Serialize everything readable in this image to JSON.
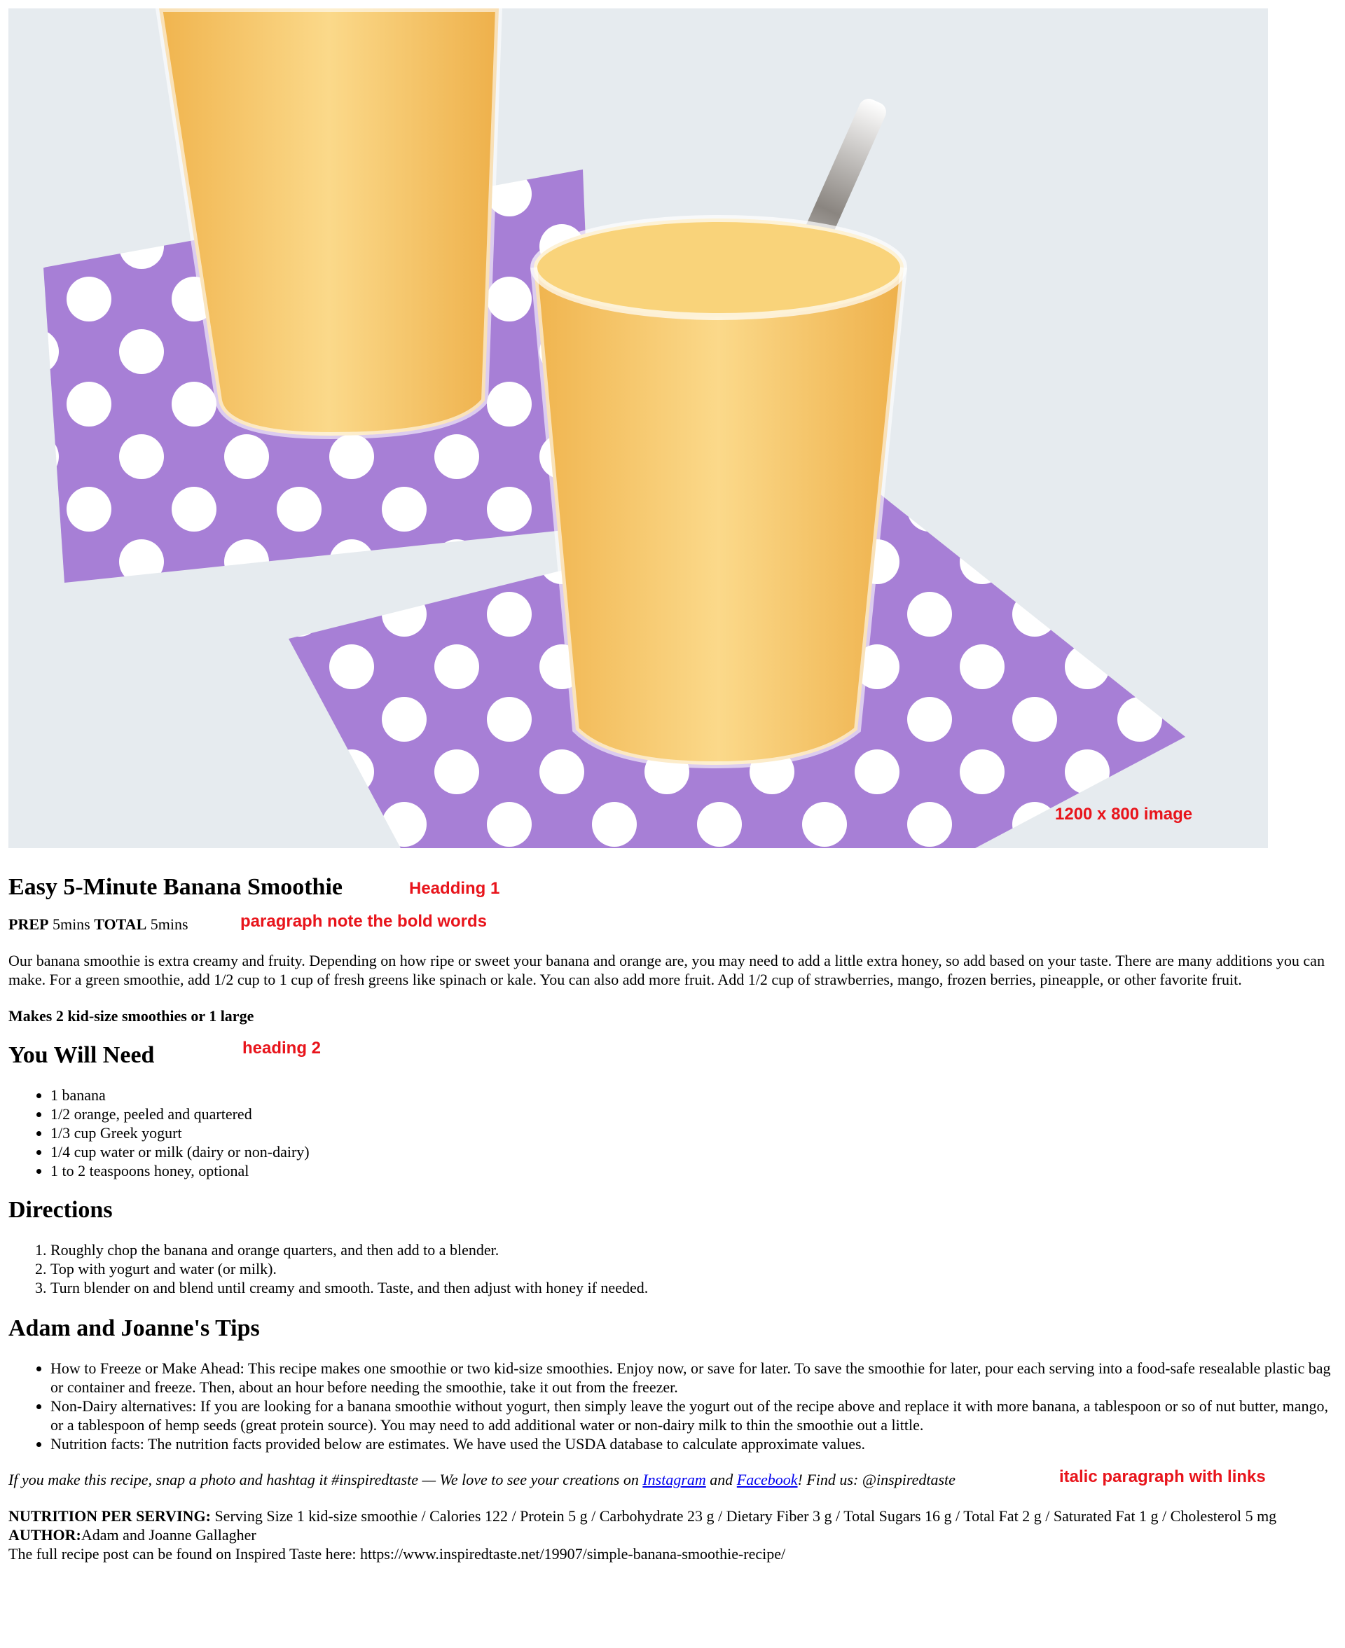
{
  "hero": {
    "note": "1200 x 800 image"
  },
  "title": {
    "text": "Easy 5-Minute Banana Smoothie",
    "note": "Headding 1"
  },
  "times": {
    "prep_label": "PREP",
    "prep_value": "5mins",
    "total_label": "TOTAL",
    "total_value": "5mins",
    "note": "paragraph note the bold words"
  },
  "intro": "Our banana smoothie is extra creamy and fruity. Depending on how ripe or sweet your banana and orange are, you may need to add a little extra honey, so add based on your taste. There are many additions you can make. For a green smoothie, add 1/2 cup to 1 cup of fresh greens like spinach or kale. You can also add more fruit. Add 1/2 cup of strawberries, mango, frozen berries, pineapple, or other favorite fruit.",
  "yield": "Makes 2 kid-size smoothies or 1 large",
  "need": {
    "heading": "You Will Need",
    "note": "heading 2",
    "items": [
      "1 banana",
      "1/2 orange, peeled and quartered",
      "1/3 cup Greek yogurt",
      "1/4 cup water or milk (dairy or non-dairy)",
      "1 to 2 teaspoons honey, optional"
    ]
  },
  "directions": {
    "heading": "Directions",
    "steps": [
      "Roughly chop the banana and orange quarters, and then add to a blender.",
      "Top with yogurt and water (or milk).",
      "Turn blender on and blend until creamy and smooth. Taste, and then adjust with honey if needed."
    ]
  },
  "tips": {
    "heading": "Adam and Joanne's Tips",
    "items": [
      "How to Freeze or Make Ahead: This recipe makes one smoothie or two kid-size smoothies. Enjoy now, or save for later. To save the smoothie for later, pour each serving into a food-safe resealable plastic bag or container and freeze. Then, about an hour before needing the smoothie, take it out from the freezer.",
      "Non-Dairy alternatives: If you are looking for a banana smoothie without yogurt, then simply leave the yogurt out of the recipe above and replace it with more banana, a tablespoon or so of nut butter, mango, or a tablespoon of hemp seeds (great protein source). You may need to add additional water or non-dairy milk to thin the smoothie out a little.",
      "Nutrition facts: The nutrition facts provided below are estimates. We have used the USDA database to calculate approximate values."
    ]
  },
  "share": {
    "before": "If you make this recipe, snap a photo and hashtag it #inspiredtaste — We love to see your creations on ",
    "instagram": "Instagram",
    "and": " and ",
    "facebook": "Facebook",
    "after": "! Find us: @inspiredtaste",
    "note": "italic paragraph with links"
  },
  "nutrition": {
    "label": "NUTRITION PER SERVING:",
    "text": " Serving Size 1 kid-size smoothie / Calories 122 / Protein 5 g / Carbohydrate 23 g / Dietary Fiber 3 g / Total Sugars 16 g / Total Fat 2 g / Saturated Fat 1 g / Cholesterol 5 mg"
  },
  "author": {
    "label": "AUTHOR:",
    "name": "Adam and Joanne Gallagher"
  },
  "source": "The full recipe post can be found on Inspired Taste here: https://www.inspiredtaste.net/19907/simple-banana-smoothie-recipe/",
  "colors": {
    "annotation": "#e8141b",
    "link": "#0000ee",
    "napkin": "#a77fd6",
    "smoothie": "#f7cc74"
  }
}
